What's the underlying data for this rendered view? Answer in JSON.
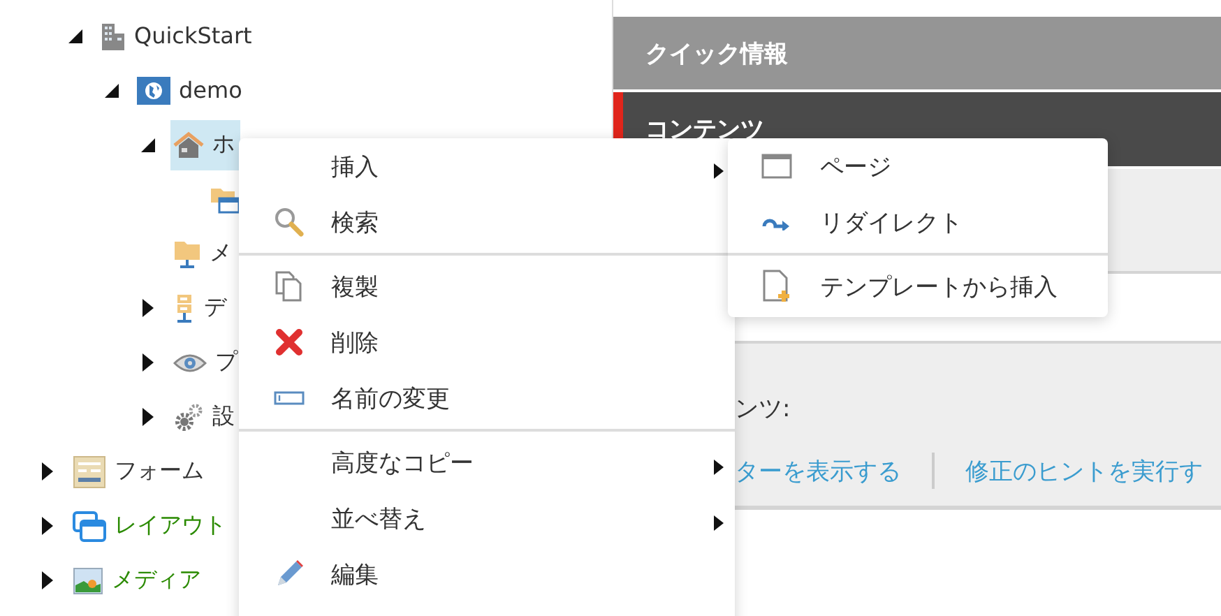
{
  "content_tree": [
    {
      "label": "QuickStart",
      "kind": "site",
      "expanded": true,
      "selected": false,
      "children": [
        {
          "label": "demo",
          "kind": "globe",
          "expanded": true,
          "selected": false,
          "children": [
            {
              "label": "ホ",
              "kind": "home",
              "expanded": true,
              "selected": true,
              "children": [
                {
                  "kind": "folder-window",
                  "selected": false
                }
              ]
            },
            {
              "label": "メ",
              "kind": "folder-net",
              "selected": false
            },
            {
              "label": "デ",
              "kind": "server",
              "expanded": false,
              "selected": false
            },
            {
              "label": "プ",
              "kind": "eye",
              "expanded": false,
              "selected": false
            },
            {
              "label": "設",
              "kind": "gears",
              "expanded": false,
              "selected": false
            }
          ]
        }
      ]
    }
  ],
  "apps": [
    {
      "label": "フォーム",
      "kind": "form",
      "expanded": false,
      "selected": false,
      "color": "#333333"
    },
    {
      "label": "レイアウト",
      "kind": "layouts",
      "expanded": false,
      "selected": false,
      "color": "#2a8a00"
    },
    {
      "label": "メディア",
      "kind": "media",
      "expanded": false,
      "selected": false,
      "color": "#2a8a00"
    }
  ],
  "sections": [
    {
      "title": "クイック情報",
      "active": false
    },
    {
      "title": "コンテンツ",
      "active": true
    }
  ],
  "content_label": "ンツ:",
  "links": [
    "ターを表示する",
    "修正のヒントを実行す"
  ],
  "context_menu": {
    "items": [
      {
        "kind": "plain",
        "label": "挿入",
        "submenu": true
      },
      {
        "kind": "search",
        "label": "検索",
        "submenu": false
      },
      {
        "kind": "separator"
      },
      {
        "kind": "copy",
        "label": "複製",
        "submenu": false
      },
      {
        "kind": "delete",
        "label": "削除",
        "submenu": false
      },
      {
        "kind": "rename",
        "label": "名前の変更",
        "submenu": false
      },
      {
        "kind": "separator"
      },
      {
        "kind": "plain",
        "label": "高度なコピー",
        "submenu": true
      },
      {
        "kind": "plain",
        "label": "並べ替え",
        "submenu": true
      },
      {
        "kind": "edit",
        "label": "編集",
        "submenu": false
      }
    ]
  },
  "submenu": {
    "items": [
      {
        "kind": "page",
        "label": "ページ"
      },
      {
        "kind": "redirect",
        "label": "リダイレクト"
      },
      {
        "kind": "separator"
      },
      {
        "kind": "template",
        "label": "テンプレートから挿入"
      }
    ]
  }
}
